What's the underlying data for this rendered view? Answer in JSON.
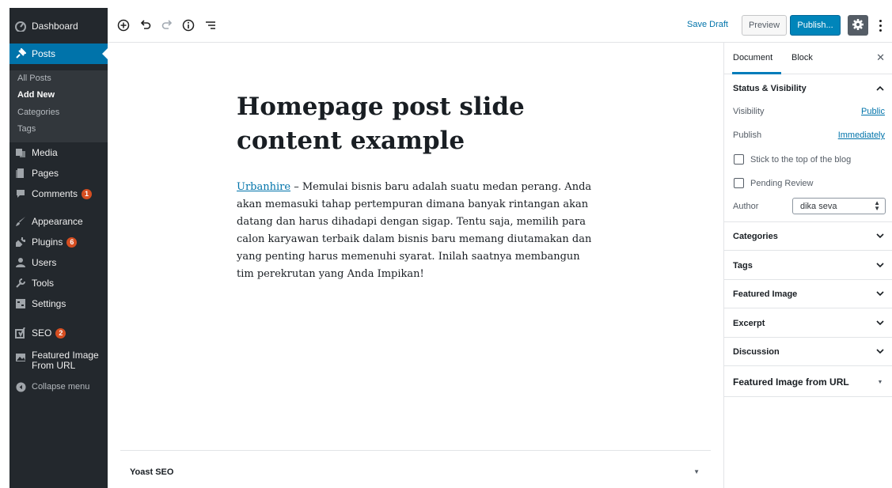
{
  "admin_menu": {
    "items": [
      {
        "label": "Dashboard",
        "icon": "dashboard-icon"
      },
      {
        "label": "Posts",
        "icon": "pin-icon"
      },
      {
        "label": "Media",
        "icon": "media-icon"
      },
      {
        "label": "Pages",
        "icon": "pages-icon"
      },
      {
        "label": "Comments",
        "icon": "comments-icon",
        "badge": "1"
      },
      {
        "label": "Appearance",
        "icon": "brush-icon"
      },
      {
        "label": "Plugins",
        "icon": "plugin-icon",
        "badge": "6"
      },
      {
        "label": "Users",
        "icon": "users-icon"
      },
      {
        "label": "Tools",
        "icon": "wrench-icon"
      },
      {
        "label": "Settings",
        "icon": "settings-icon"
      },
      {
        "label": "SEO",
        "icon": "yoast-icon",
        "badge": "2"
      },
      {
        "label": "Featured Image",
        "label2": "From URL",
        "icon": "image-icon"
      },
      {
        "label": "Collapse menu",
        "icon": "collapse-icon"
      }
    ],
    "posts_submenu": [
      "All Posts",
      "Add New",
      "Categories",
      "Tags"
    ]
  },
  "toolbar": {
    "save_draft": "Save Draft",
    "preview": "Preview",
    "publish": "Publish..."
  },
  "post": {
    "title": "Homepage post slide content example",
    "content_link": "Urbanhire",
    "content_rest": " – Memulai bisnis baru adalah suatu medan perang. Anda akan memasuki tahap pertempuran dimana banyak rintangan akan datang dan harus dihadapi dengan sigap. Tentu saja, memilih para calon karyawan terbaik dalam bisnis baru memang diutamakan dan yang penting harus memenuhi syarat. Inilah saatnya membangun tim perekrutan yang Anda Impikan!"
  },
  "yoast": {
    "title": "Yoast SEO"
  },
  "settings": {
    "tabs": [
      "Document",
      "Block"
    ],
    "status_visibility": {
      "title": "Status & Visibility",
      "visibility_label": "Visibility",
      "visibility_value": "Public",
      "publish_label": "Publish",
      "publish_value": "Immediately",
      "sticky_label": "Stick to the top of the blog",
      "pending_label": "Pending Review",
      "author_label": "Author",
      "author_value": "dika seva"
    },
    "panels": [
      "Categories",
      "Tags",
      "Featured Image",
      "Excerpt",
      "Discussion",
      "Featured Image from URL"
    ]
  },
  "colors": {
    "admin_bg": "#23282d",
    "admin_current": "#0073aa",
    "publish_button": "#0085ba",
    "badge": "#d54e21",
    "link": "#0073aa"
  }
}
